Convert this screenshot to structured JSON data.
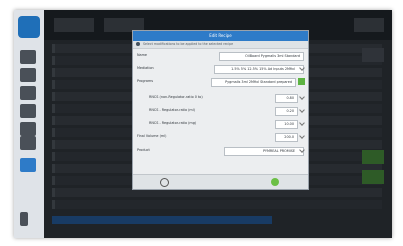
{
  "dialog": {
    "title": "Edit Recipe",
    "subtitle": "Select modifications to be applied to the selected recipe",
    "fields": [
      {
        "label": "Name",
        "value": "OilBoard Pygmalis 3ml Standard"
      },
      {
        "label": "Mediation",
        "value": "1.5% 5% 12.5% 15% Ad Inputs 2Mfixl"
      },
      {
        "label": "Programs",
        "value": "Pygmalis 3ml 2Mfixl Standard prepared"
      },
      {
        "label": "RNCS (non-Regulator-ratio 0 to)",
        "value": "0.80"
      },
      {
        "label": "RNCS - Regulator-ratio (ml)",
        "value": "0.20"
      },
      {
        "label": "RNCS - Regulator-ratio (mg)",
        "value": "10.00"
      },
      {
        "label": "Final Volume (ml)",
        "value": "200.0"
      },
      {
        "label": "Product",
        "value": "PYMREAL PROMISE"
      }
    ]
  },
  "colors": {
    "title_bar": "#2e7bc8",
    "ok_button": "#6bbf45",
    "accent_green": "#5db342"
  },
  "icons": {
    "cancel": "close-circle-icon",
    "ok": "check-icon"
  }
}
